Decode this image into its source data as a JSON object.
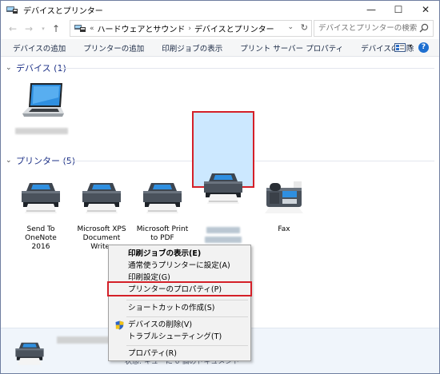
{
  "window": {
    "title": "デバイスとプリンター",
    "controls": {
      "minimize": "—",
      "maximize": "☐",
      "close": "✕"
    }
  },
  "address": {
    "back": "←",
    "forward": "→",
    "up": "↑",
    "overflow": "«",
    "crumbs": [
      "ハードウェアとサウンド",
      "デバイスとプリンター"
    ],
    "separator": "›",
    "dropdown": "⌄",
    "refresh": "↻"
  },
  "search": {
    "placeholder": "デバイスとプリンターの検索"
  },
  "commands": [
    "デバイスの追加",
    "プリンターの追加",
    "印刷ジョブの表示",
    "プリント サーバー プロパティ",
    "デバイスの削除"
  ],
  "help_label": "?",
  "view_dropdown": "▾",
  "groups": {
    "devices": {
      "chevron": "⌄",
      "title": "デバイス (1)"
    },
    "printers": {
      "chevron": "⌄",
      "title": "プリンター (5)"
    }
  },
  "printers": [
    {
      "label1": "Send To OneNote",
      "label2": "2016"
    },
    {
      "label1": "Microsoft XPS",
      "label2": "Document Writer"
    },
    {
      "label1": "Microsoft Print",
      "label2": "to PDF"
    },
    {
      "label1": "",
      "label2": ""
    },
    {
      "label1": "Fax",
      "label2": ""
    }
  ],
  "context_menu": {
    "items": [
      {
        "label": "印刷ジョブの表示(E)",
        "bold": true
      },
      {
        "label": "通常使うプリンターに設定(A)",
        "bold": false
      },
      {
        "label": "印刷設定(G)",
        "bold": false
      },
      {
        "label": "プリンターのプロパティ(P)",
        "bold": false
      },
      {
        "label": "ショートカットの作成(S)",
        "bold": false
      },
      {
        "label": "デバイスの削除(V)",
        "bold": false
      },
      {
        "label": "トラブルシューティング(T)",
        "bold": false
      },
      {
        "label": "プロパティ(R)",
        "bold": false
      }
    ]
  },
  "details": {
    "status": "状態: キューに 0 個のドキュメント"
  },
  "colors": {
    "selection": "#cce8ff",
    "highlight_border": "#d42028",
    "group_title": "#1e3287",
    "details_bg": "#f0f5fb"
  }
}
